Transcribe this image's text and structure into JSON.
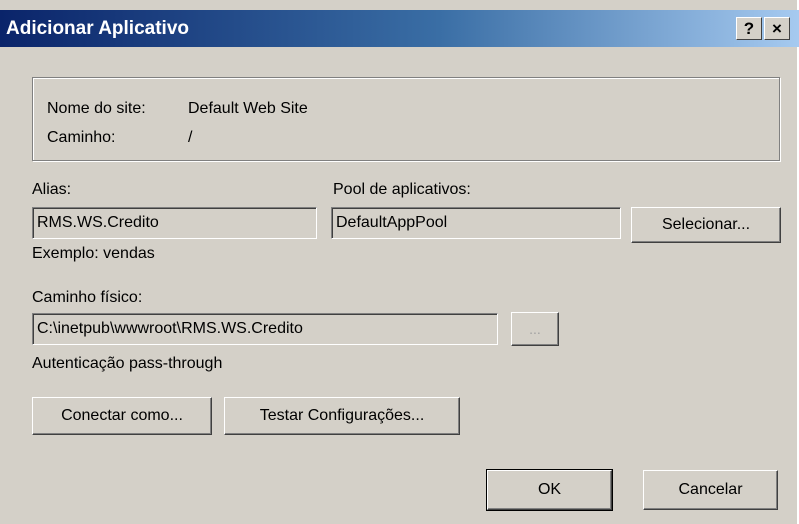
{
  "window": {
    "title": "Adicionar Aplicativo",
    "help_label": "?",
    "close_label": "×"
  },
  "site_info": {
    "site_name_label": "Nome do site:",
    "site_name_value": "Default Web Site",
    "path_label": "Caminho:",
    "path_value": "/"
  },
  "alias": {
    "label": "Alias:",
    "value": "RMS.WS.Credito",
    "example": "Exemplo: vendas"
  },
  "pool": {
    "label": "Pool de aplicativos:",
    "value": "DefaultAppPool",
    "select_button": "Selecionar..."
  },
  "physical_path": {
    "label": "Caminho físico:",
    "value": "C:\\inetpub\\wwwroot\\RMS.WS.Credito",
    "browse_button": "..."
  },
  "auth_text": "Autenticação pass-through",
  "buttons": {
    "connect_as": "Conectar como...",
    "test_settings": "Testar Configurações...",
    "ok": "OK",
    "cancel": "Cancelar"
  },
  "colors": {
    "title_gradient_start": "#0a246a",
    "title_gradient_end": "#a6caf0",
    "dialog_bg": "#d4d0c8"
  }
}
